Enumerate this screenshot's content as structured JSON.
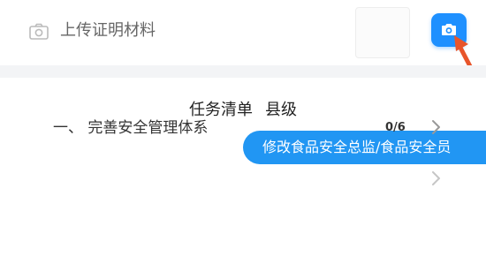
{
  "upload": {
    "label": "上传证明材料"
  },
  "task_list": {
    "title": "任务清单",
    "level": "县级",
    "modify_button_label": "修改食品安全总监/食品安全员",
    "items": [
      {
        "label": "一、 完善安全管理体系",
        "count": "0/6"
      },
      {
        "label": "",
        "count": ""
      }
    ]
  },
  "colors": {
    "accent": "#2196f3",
    "annotation_arrow": "#e8552b"
  },
  "icons": {
    "upload": "camera-outline-icon",
    "camera_button": "camera-icon",
    "row_arrow": "chevron-right-icon"
  }
}
